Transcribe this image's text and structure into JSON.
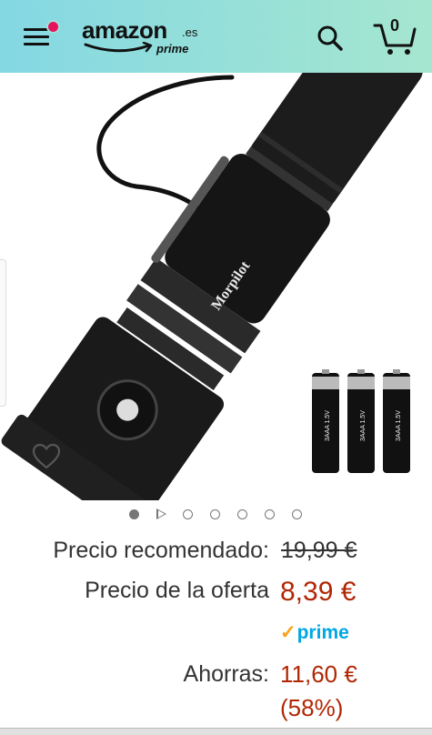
{
  "header": {
    "logo_word": "amazon",
    "logo_tld": ".es",
    "logo_sub": "prime",
    "cart_count": "0"
  },
  "product": {
    "brand_on_image": "Morpilot",
    "battery_label": "3AAA 1.5V"
  },
  "gallery": {
    "image_count": 7,
    "active_index": 0
  },
  "pricing": {
    "list_label": "Precio recomendado:",
    "list_price": "19,99 €",
    "deal_label": "Precio de la oferta",
    "deal_price": "8,39 €",
    "prime_label": "prime",
    "savings_label": "Ahorras:",
    "savings_amount": "11,60 €",
    "savings_percent": "(58%)"
  },
  "colors": {
    "header_start": "#84d8e3",
    "header_end": "#a5e6cf",
    "price_red": "#b12704",
    "prime_blue": "#00a8e1",
    "notif_pink": "#e8145a"
  },
  "icons": [
    "menu-icon",
    "search-icon",
    "cart-icon",
    "heart-icon",
    "play-icon"
  ]
}
